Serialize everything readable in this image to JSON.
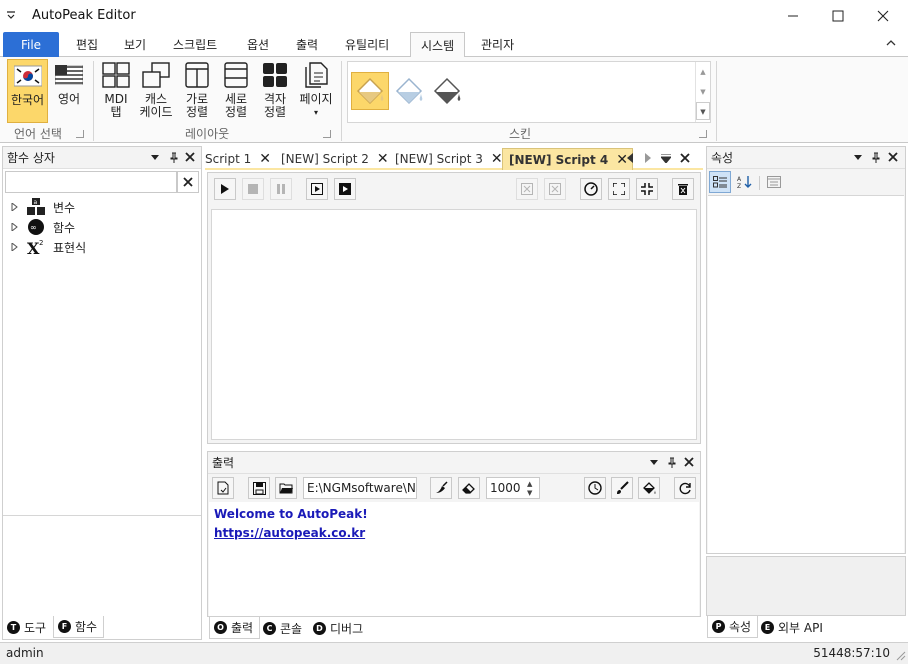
{
  "app": {
    "title": "AutoPeak Editor"
  },
  "menu_tabs": [
    "File",
    "편집",
    "보기",
    "스크립트",
    "옵션",
    "출력",
    "유틸리티",
    "시스템",
    "관리자"
  ],
  "ribbon": {
    "language_group": {
      "label": "언어 선택",
      "korean": "한국어",
      "english": "영어"
    },
    "layout_group": {
      "label": "레이아웃",
      "mdi_tab": [
        "MDI",
        "탭"
      ],
      "cascade": [
        "캐스",
        "케이드"
      ],
      "horizontal": [
        "가로",
        "정렬"
      ],
      "vertical": [
        "세로",
        "정렬"
      ],
      "grid": [
        "격자",
        "정렬"
      ],
      "page": [
        "페이지",
        "▾"
      ]
    },
    "skin_group": {
      "label": "스킨"
    }
  },
  "left_panel": {
    "title": "함수 상자",
    "search_placeholder": "",
    "tree": [
      "변수",
      "함수",
      "표현식"
    ],
    "bottom_tabs": [
      {
        "key": "T",
        "label": "도구"
      },
      {
        "key": "F",
        "label": "함수"
      }
    ]
  },
  "documents": {
    "tabs": [
      "Script 1",
      "[NEW] Script 2",
      "[NEW] Script 3",
      "[NEW] Script 4"
    ],
    "active_index": 3
  },
  "output": {
    "title": "출력",
    "path": "E:\\NGMsoftware\\NG",
    "line_limit": "1000",
    "lines": [
      "Welcome to AutoPeak!",
      "https://autopeak.co.kr"
    ],
    "bottom_tabs": [
      {
        "key": "O",
        "label": "출력"
      },
      {
        "key": "C",
        "label": "콘솔"
      },
      {
        "key": "D",
        "label": "디버그"
      }
    ]
  },
  "right_panel": {
    "title": "속성",
    "bottom_tabs": [
      {
        "key": "P",
        "label": "속성"
      },
      {
        "key": "E",
        "label": "외부 API"
      }
    ]
  },
  "status": {
    "user": "admin",
    "clock": "51448:57:10"
  },
  "colors": {
    "accent": "#2c6fd6",
    "active_tab": "#fbe6a2",
    "link": "#1a1ab8",
    "hover_button": "#fcd76a"
  }
}
